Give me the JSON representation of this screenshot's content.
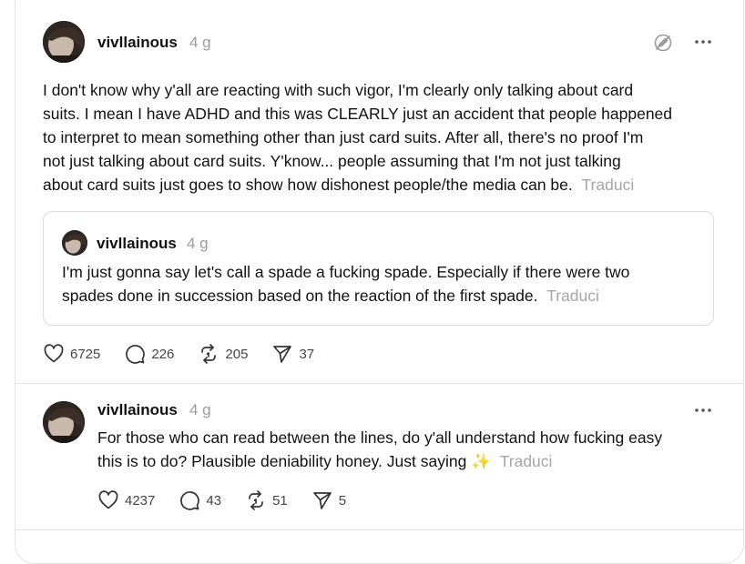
{
  "post": {
    "username": "vivllainous",
    "time": "4 g",
    "text_lines": [
      "I don't know why y'all are reacting with such vigor, I'm clearly only talking about card",
      "suits. I mean I have ADHD and this was CLEARLY just an accident that people happened",
      "to interpret to mean something other than just card suits. After all, there's no proof I'm",
      "not just talking about card suits. Y'know... people assuming that I'm not just talking",
      "about card suits just goes to show how dishonest people/the media can be."
    ],
    "translate_label": "Traduci",
    "quote": {
      "username": "vivllainous",
      "time": "4 g",
      "text_lines": [
        "I'm just gonna say let's call a spade a fucking spade. Especially if there were two",
        "spades done in succession based on the reaction of the first spade."
      ],
      "translate_label": "Traduci"
    },
    "stats": {
      "likes": "6725",
      "replies": "226",
      "reposts": "205",
      "shares": "37"
    }
  },
  "reply": {
    "username": "vivllainous",
    "time": "4 g",
    "text_lines": [
      "For those who can read between the lines, do y'all understand how fucking easy",
      "this is to do? Plausible deniability honey. Just saying ✨"
    ],
    "translate_label": "Traduci",
    "stats": {
      "likes": "4237",
      "replies": "43",
      "reposts": "51",
      "shares": "5"
    }
  },
  "icons": {
    "more": "more-icon",
    "edit": "no-edit-icon",
    "like": "heart-icon",
    "reply": "comment-icon",
    "repost": "repost-icon",
    "share": "send-icon"
  },
  "colors": {
    "muted": "#9a9a9a",
    "border": "#e3e3e3",
    "text": "#111111"
  }
}
